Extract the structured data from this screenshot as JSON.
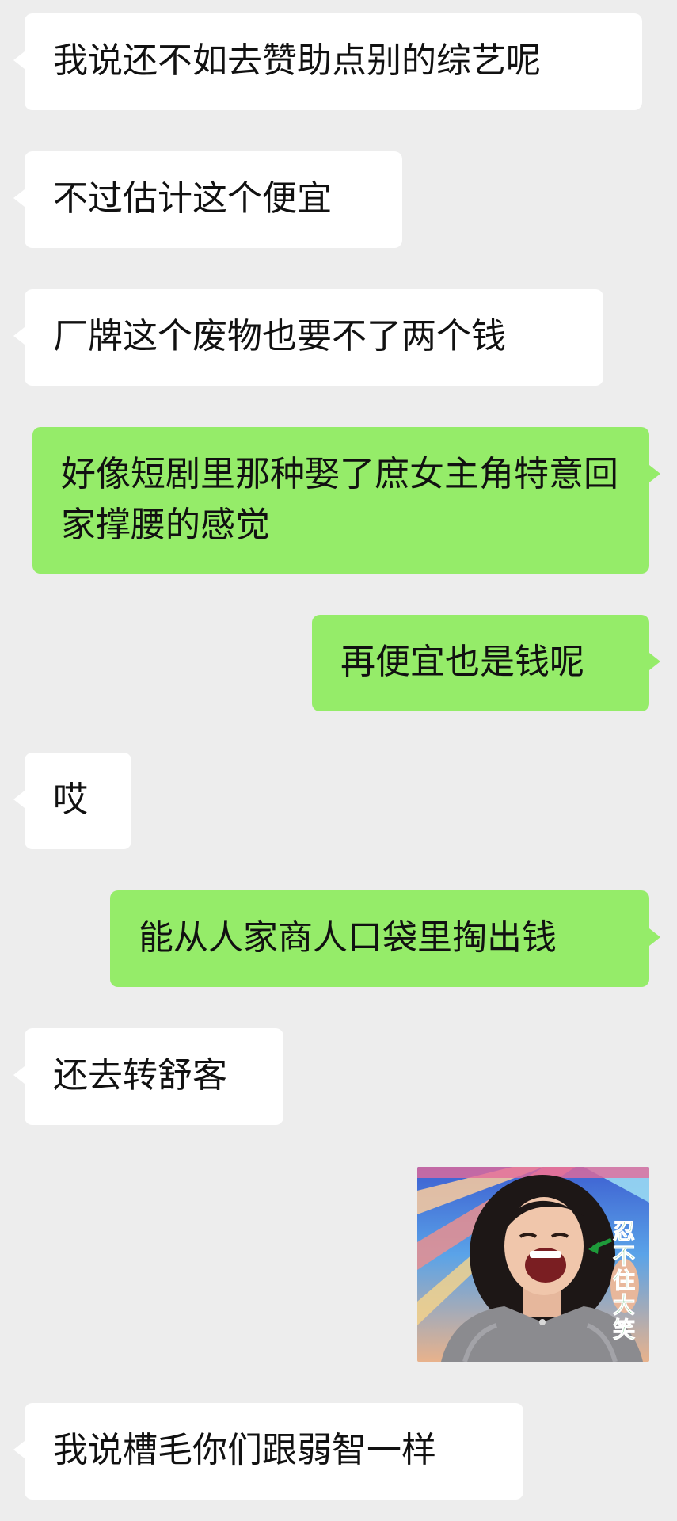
{
  "messages": [
    {
      "side": "in",
      "text": "我说还不如去赞助点别的综艺呢"
    },
    {
      "side": "in",
      "text": "不过估计这个便宜"
    },
    {
      "side": "in",
      "text": "厂牌这个废物也要不了两个钱"
    },
    {
      "side": "out",
      "text": "好像短剧里那种娶了庶女主角特意回家撑腰的感觉"
    },
    {
      "side": "out",
      "text": "再便宜也是钱呢"
    },
    {
      "side": "in",
      "text": "哎"
    },
    {
      "side": "out",
      "text": "能从人家商人口袋里掏出钱"
    },
    {
      "side": "in",
      "text": "还去转舒客"
    },
    {
      "side": "out",
      "type": "sticker",
      "caption": "忍不住大笑",
      "icon": "laughing-woman-sticker"
    },
    {
      "side": "in",
      "text": "我说槽毛你们跟弱智一样"
    }
  ],
  "colors": {
    "background": "#ededed",
    "incoming_bubble": "#ffffff",
    "outgoing_bubble": "#95ec69",
    "text": "#111111"
  }
}
